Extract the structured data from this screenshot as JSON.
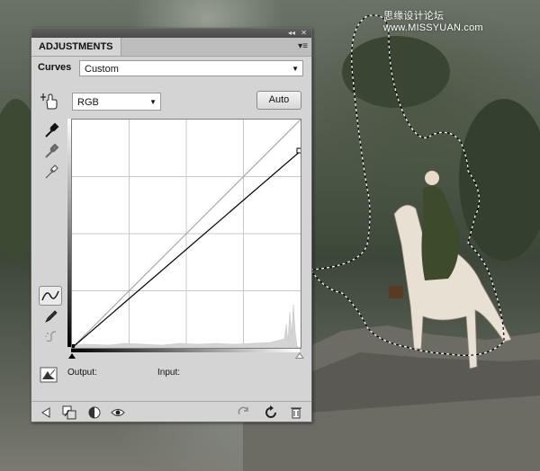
{
  "watermark": "思缘设计论坛 www.MISSYUAN.com",
  "panel": {
    "tab_label": "ADJUSTMENTS",
    "adjustment_name": "Curves",
    "preset_value": "Custom",
    "channel_value": "RGB",
    "auto_label": "Auto",
    "output_label": "Output:",
    "input_label": "Input:"
  },
  "icons": {
    "header": [
      "collapse-icon",
      "close-icon",
      "panel-menu-icon"
    ],
    "tools": [
      "on-image-adjust-hand-icon",
      "black-point-eyedropper-icon",
      "gray-point-eyedropper-icon",
      "white-point-eyedropper-icon",
      "curve-edit-points-icon",
      "pencil-draw-icon",
      "smooth-curve-icon",
      "clipping-warning-icon"
    ],
    "footer": [
      "back-arrow-icon",
      "clip-to-layer-icon",
      "toggle-view-previous-icon",
      "visibility-eye-icon",
      "reset-link-icon",
      "reset-to-default-icon",
      "trash-icon"
    ]
  },
  "colors": {
    "panel_bg": "#d4d4d4",
    "curve": "#000000",
    "diagonal": "#a0a0a0",
    "grid": "#c8c8c8"
  }
}
